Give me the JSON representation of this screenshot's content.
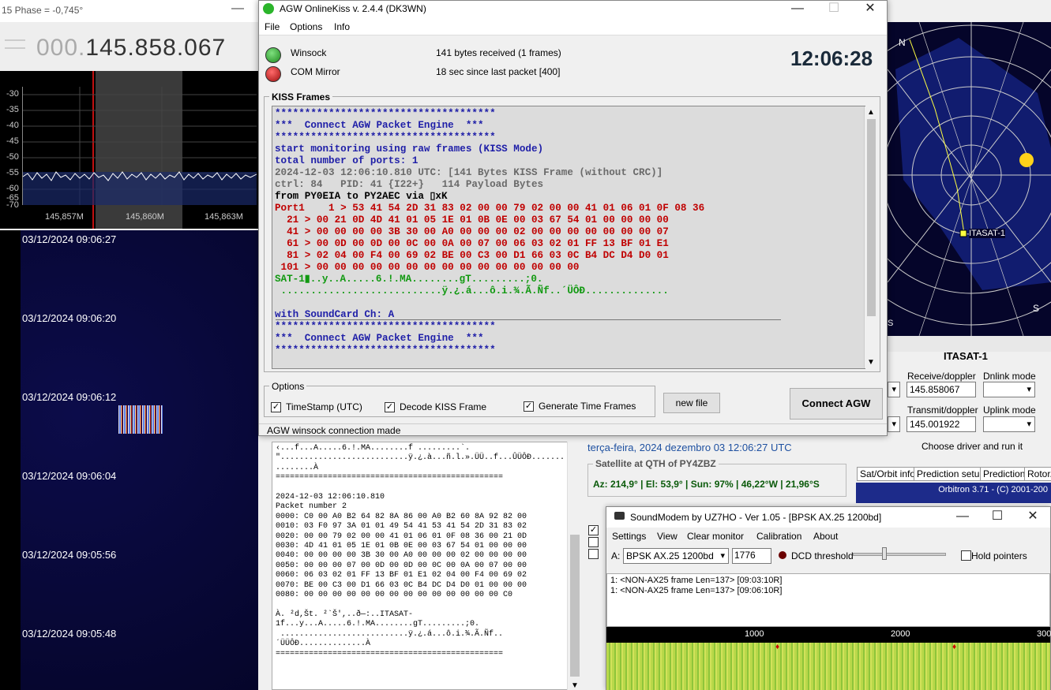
{
  "sdr": {
    "title": "15 Phase = -0,745°",
    "freq_dim": "000.",
    "freq": "145.858.067",
    "db_labels": [
      "-30",
      "-35",
      "-40",
      "-45",
      "-50",
      "-55",
      "-60",
      "-65",
      "-70"
    ],
    "freq_labels": [
      "145,857M",
      "145,860M",
      "145,863M"
    ],
    "timestamps": [
      "03/12/2024 09:06:27",
      "03/12/2024 09:06:20",
      "03/12/2024 09:06:12",
      "03/12/2024 09:06:04",
      "03/12/2024 09:05:56",
      "03/12/2024 09:05:48"
    ]
  },
  "agw": {
    "title": "AGW OnlineKiss v. 2.4.4  (DK3WN)",
    "menu": [
      "File",
      "Options",
      "Info"
    ],
    "winsock_label": "Winsock",
    "com_label": "COM Mirror",
    "winsock_status": "141 bytes received (1 frames)",
    "com_status": "18 sec since last packet [400]",
    "clock": "12:06:28",
    "kiss_legend": "KISS Frames",
    "kiss_lines": [
      {
        "t": "*************************************",
        "c": "#1f1fa8"
      },
      {
        "t": "***  Connect AGW Packet Engine  ***",
        "c": "#1f1fa8"
      },
      {
        "t": "*************************************",
        "c": "#1f1fa8"
      },
      {
        "t": "start monitoring using raw frames (KISS Mode)",
        "c": "#1f1fa8"
      },
      {
        "t": "total number of ports: 1",
        "c": "#1f1fa8"
      },
      {
        "t": "2024-12-03 12:06:10.810 UTC: [141 Bytes KISS Frame (without CRC)]",
        "c": "#6a6a6a"
      },
      {
        "t": "ctrl: 84   PID: 41 {I22+}   114 Payload Bytes",
        "c": "#6a6a6a"
      },
      {
        "t": "from PY0EIA to PY2AEC via ▯xK",
        "c": "#000000"
      },
      {
        "t": "Port1    1 > 53 41 54 2D 31 83 02 00 00 79 02 00 00 41 01 06 01 0F 08 36",
        "c": "#c00000"
      },
      {
        "t": "  21 > 00 21 0D 4D 41 01 05 1E 01 0B 0E 00 03 67 54 01 00 00 00 00",
        "c": "#c00000"
      },
      {
        "t": "  41 > 00 00 00 00 3B 30 00 A0 00 00 00 02 00 00 00 00 00 00 00 07",
        "c": "#c00000"
      },
      {
        "t": "  61 > 00 0D 00 0D 00 0C 00 0A 00 07 00 06 03 02 01 FF 13 BF 01 E1",
        "c": "#c00000"
      },
      {
        "t": "  81 > 02 04 00 F4 00 69 02 BE 00 C3 00 D1 66 03 0C B4 DC D4 D0 01",
        "c": "#c00000"
      },
      {
        "t": " 101 > 00 00 00 00 00 00 00 00 00 00 00 00 00 00 00",
        "c": "#c00000"
      },
      {
        "t": "SAT-1▮..y..A.....6.!.MA........gT.........;0.",
        "c": "#119911"
      },
      {
        "t": " ...........................ÿ.¿.á...ô.i.¾.Ã.Ñf..´ÜÔÐ..............",
        "c": "#119911"
      },
      {
        "t": "",
        "c": "#000000"
      },
      {
        "t": "with SoundCard Ch: A",
        "c": "#1f1fa8"
      },
      {
        "t": "*************************************",
        "c": "#1f1fa8"
      },
      {
        "t": "***  Connect AGW Packet Engine  ***",
        "c": "#1f1fa8"
      },
      {
        "t": "*************************************",
        "c": "#1f1fa8"
      }
    ],
    "options_legend": "Options",
    "opt_timestamp": "TimeStamp (UTC)",
    "opt_decode": "Decode KISS Frame",
    "opt_timeframes": "Generate Time Frames",
    "newfile_btn": "new file",
    "connect_btn": "Connect AGW",
    "status": "AGW winsock connection made"
  },
  "mid": {
    "log": "‹...f...A.....6.!.MA........f .........`.\n\"...........................ÿ.¿.à...ñ.l.».ÜÜ..f...ÛÜÔÐ.......\n........À\n================================================\n\n2024-12-03 12:06:10.810\nPacket number 2\n0000: C0 00 A0 B2 64 82 8A 86 00 A0 B2 60 8A 92 82 00\n0010: 03 F0 97 3A 01 01 49 54 41 53 41 54 2D 31 83 02\n0020: 00 00 79 02 00 00 41 01 06 01 0F 08 36 00 21 0D\n0030: 4D 41 01 05 1E 01 0B 0E 00 03 67 54 01 00 00 00\n0040: 00 00 00 00 3B 30 00 A0 00 00 00 02 00 00 00 00\n0050: 00 00 00 07 00 0D 00 0D 00 0C 00 0A 00 07 00 00\n0060: 06 03 02 01 FF 13 BF 01 E1 02 04 00 F4 00 69 02\n0070: BE 00 C3 00 D1 66 03 0C B4 DC D4 D0 01 00 00 00\n0080: 00 00 00 00 00 00 00 00 00 00 00 00 00 00 C0\n\nÀ. ²d,Št. ²`Š',..ð—:..ITASAT-\n1f...y...A.....6.!.MA........gT.........;0.\n ...........................ÿ.¿.á...ô.i.¾.Ã.Ñf..\n´ÜÜÔÐ..............À\n================================================",
    "date": "terça-feira, 2024 dezembro 03  12:06:27 UTC",
    "sat_legend": "Satellite at QTH of PY4ZBZ",
    "sat_text": "Az: 214,9° | El: 53,9° | Sun: 97% | 46,22°W | 21,96°S"
  },
  "orbitron": {
    "sat_name": "ITASAT-1",
    "map_sat_label": "ITASAT-1",
    "compass_n": "N",
    "compass_s": "S",
    "compass_s2": "S",
    "rx_label": "Receive/doppler",
    "dl_label": "Dnlink mode",
    "rx_value": "145.858067",
    "tx_label": "Transmit/doppler",
    "ul_label": "Uplink mode",
    "tx_value": "145.001922",
    "driver_text": "Choose driver and run it",
    "tabs": [
      "Sat/Orbit info",
      "Prediction setup",
      "Prediction",
      "Rotor/"
    ],
    "footer": "Orbitron 3.71 - (C) 2001-200"
  },
  "soundmodem": {
    "title": "SoundModem by UZ7HO - Ver 1.05 - [BPSK AX.25 1200bd]",
    "menu": [
      "Settings",
      "View",
      "Clear monitor",
      "Calibration",
      "About"
    ],
    "channel_label": "A:",
    "mode_value": "BPSK AX.25 1200bd",
    "freq_value": "1776",
    "dcd_label": "DCD threshold",
    "hold_label": "Hold pointers",
    "log_lines": [
      "1: <NON-AX25 frame Len=137> [09:03:10R]",
      "1: <NON-AX25 frame Len=137> [09:06:10R]"
    ],
    "scale": [
      "1000",
      "2000",
      "300"
    ]
  },
  "colors": {
    "kiss_bg": "#dcdcdc",
    "accent_blue": "#1f1fa8",
    "hex_red": "#c00000",
    "ascii_green": "#119911",
    "wf_green": "#9acd32"
  }
}
